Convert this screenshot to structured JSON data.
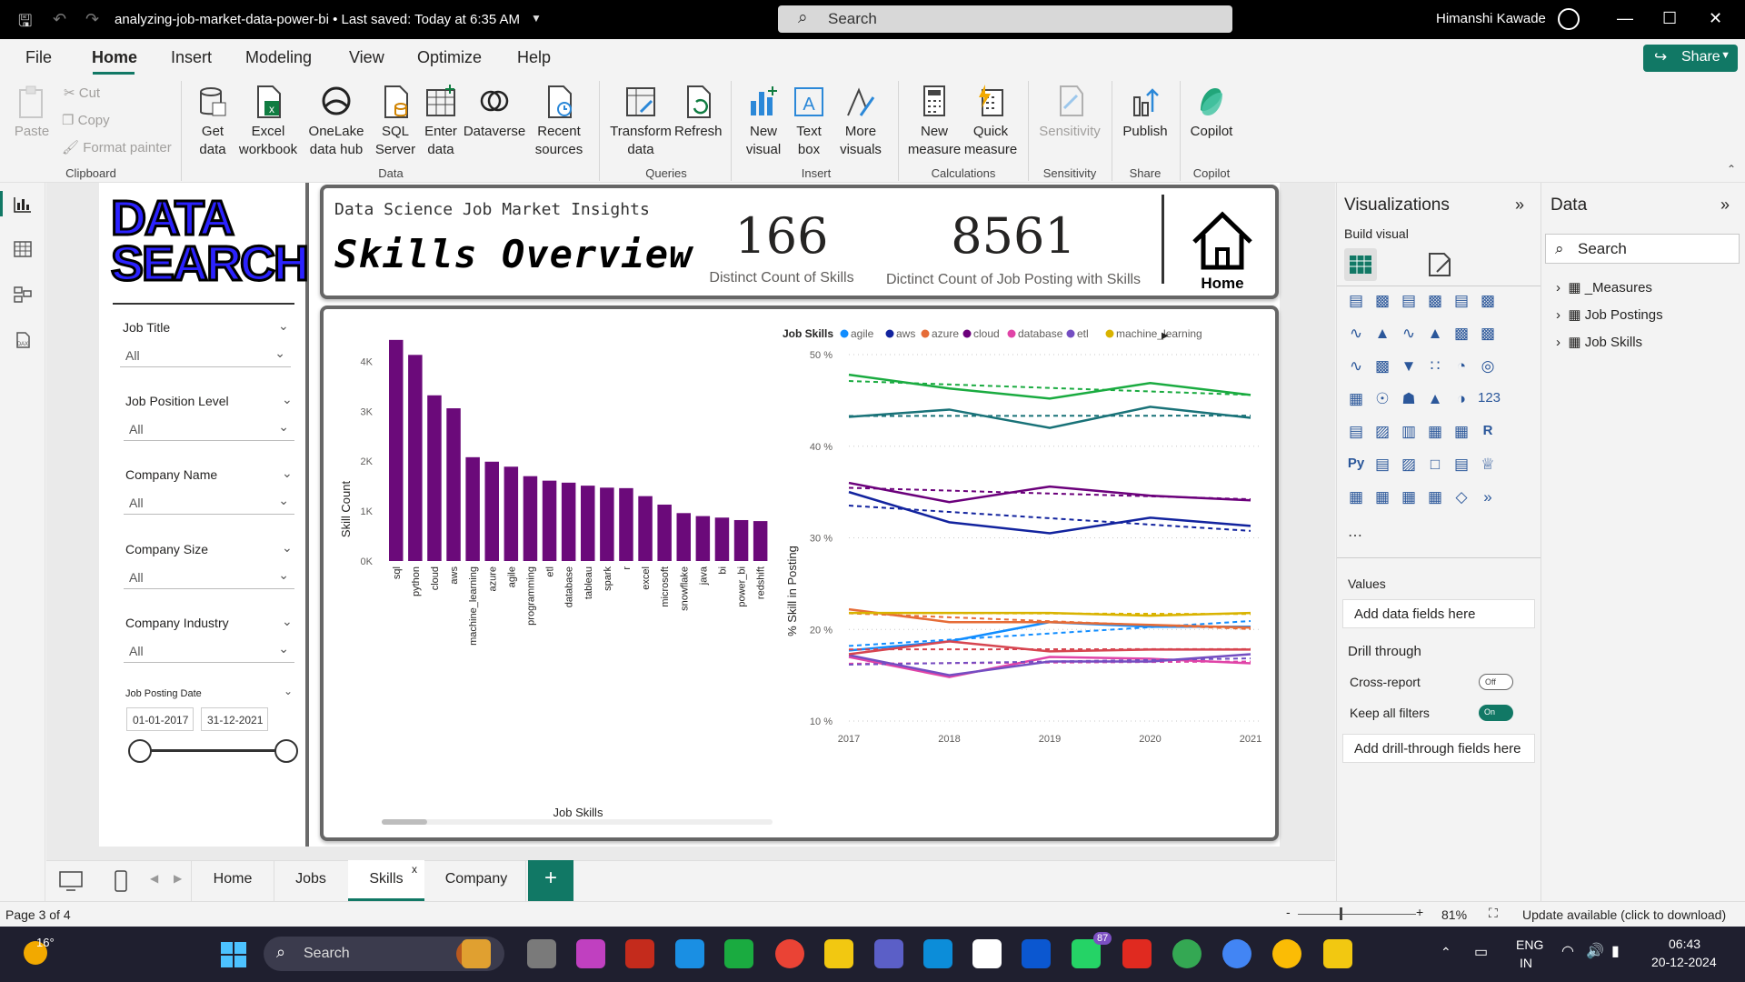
{
  "titlebar": {
    "file_title": "analyzing-job-market-data-power-bi • Last saved: Today at 6:35 AM",
    "search_placeholder": "Search",
    "user_name": "Himanshi Kawade"
  },
  "menu": [
    "File",
    "Home",
    "Insert",
    "Modeling",
    "View",
    "Optimize",
    "Help"
  ],
  "share_label": "Share",
  "ribbon": {
    "clipboard": {
      "paste": "Paste",
      "cut": "Cut",
      "copy": "Copy",
      "format_painter": "Format painter",
      "group": "Clipboard"
    },
    "data": {
      "get_data": "Get data",
      "excel": "Excel workbook",
      "onelake": "OneLake data hub",
      "sql": "SQL Server",
      "enter": "Enter data",
      "dataverse": "Dataverse",
      "recent": "Recent sources",
      "group": "Data"
    },
    "queries": {
      "transform": "Transform data",
      "refresh": "Refresh",
      "group": "Queries"
    },
    "insert": {
      "new_visual": "New visual",
      "text_box": "Text box",
      "more_visuals": "More visuals",
      "group": "Insert"
    },
    "calculations": {
      "new_measure": "New measure",
      "quick_measure": "Quick measure",
      "group": "Calculations"
    },
    "sensitivity": {
      "label": "Sensitivity",
      "group": "Sensitivity"
    },
    "share": {
      "publish": "Publish",
      "group": "Share"
    },
    "copilot": {
      "label": "Copilot",
      "group": "Copilot"
    }
  },
  "report": {
    "logo_line1": "DATA",
    "logo_line2": "SEARCH",
    "slicers": [
      {
        "label": "Job Title",
        "value": "All"
      },
      {
        "label": "Job Position Level",
        "value": "All"
      },
      {
        "label": "Company Name",
        "value": "All"
      },
      {
        "label": "Company Size",
        "value": "All"
      },
      {
        "label": "Company Industry",
        "value": "All"
      }
    ],
    "date_slicer": {
      "label": "Job Posting Date",
      "start": "01-01-2017",
      "end": "31-12-2021"
    },
    "header_small": "Data Science Job Market Insights",
    "header_big": "Skills Overview",
    "kpi1": {
      "value": "166",
      "label": "Distinct Count of Skills"
    },
    "kpi2": {
      "value": "8561",
      "label": "Dictinct Count of Job Posting with Skills"
    },
    "home_label": "Home"
  },
  "chart_data": [
    {
      "type": "bar",
      "xlabel": "Job Skills",
      "ylabel": "Skill Count",
      "ylim": [
        0,
        4500
      ],
      "yticks": [
        "0K",
        "1K",
        "2K",
        "3K",
        "4K"
      ],
      "categories": [
        "sql",
        "python",
        "cloud",
        "aws",
        "machine_learning",
        "azure",
        "agile",
        "programming",
        "etl",
        "database",
        "tableau",
        "spark",
        "r",
        "excel",
        "microsoft",
        "snowflake",
        "java",
        "bi",
        "power_bi",
        "redshift"
      ],
      "values": [
        4430,
        4130,
        3320,
        3060,
        2080,
        1990,
        1890,
        1700,
        1610,
        1570,
        1510,
        1470,
        1460,
        1300,
        1130,
        960,
        900,
        870,
        820,
        800
      ],
      "color": "#6b0a7a"
    },
    {
      "type": "line",
      "legend_title": "Job Skills",
      "xlabel": "",
      "ylabel": "% Skill in Posting",
      "x": [
        2017,
        2018,
        2019,
        2020,
        2021
      ],
      "ylim": [
        10,
        50
      ],
      "yticks": [
        "10 %",
        "20 %",
        "30 %",
        "40 %",
        "50 %"
      ],
      "legend": [
        {
          "name": "agile",
          "color": "#118dff"
        },
        {
          "name": "aws",
          "color": "#12239e"
        },
        {
          "name": "azure",
          "color": "#e66c37"
        },
        {
          "name": "cloud",
          "color": "#6b007b"
        },
        {
          "name": "database",
          "color": "#e044a7"
        },
        {
          "name": "etl",
          "color": "#744ec2"
        },
        {
          "name": "machine_learning",
          "color": "#d9b300"
        }
      ],
      "series": [
        {
          "name": "agile",
          "color": "#118dff",
          "values": [
            17.7,
            18.7,
            20.8,
            20.3,
            20.3
          ]
        },
        {
          "name": "aws",
          "color": "#12239e",
          "values": [
            35.0,
            31.7,
            30.5,
            32.2,
            31.3
          ]
        },
        {
          "name": "azure",
          "color": "#e66c37",
          "values": [
            22.2,
            20.8,
            20.8,
            20.5,
            20.2
          ]
        },
        {
          "name": "cloud",
          "color": "#6b007b",
          "values": [
            36.0,
            33.9,
            35.6,
            34.6,
            34.1
          ]
        },
        {
          "name": "database",
          "color": "#e044a7",
          "values": [
            17.0,
            14.8,
            17.0,
            16.8,
            16.3
          ]
        },
        {
          "name": "etl",
          "color": "#744ec2",
          "values": [
            17.2,
            15.0,
            16.5,
            16.5,
            17.3
          ]
        },
        {
          "name": "machine_learning",
          "color": "#d9b300",
          "values": [
            21.8,
            21.8,
            21.8,
            21.5,
            21.8
          ]
        },
        {
          "name": "",
          "color": "#1aab40",
          "values": [
            47.8,
            46.3,
            45.2,
            46.9,
            45.6
          ]
        },
        {
          "name": "",
          "color": "#197278",
          "values": [
            43.2,
            44.0,
            42.0,
            44.3,
            43.1
          ]
        },
        {
          "name": "",
          "color": "#d64550",
          "values": [
            17.3,
            18.7,
            17.6,
            17.8,
            17.8
          ]
        }
      ]
    }
  ],
  "viz_pane": {
    "title": "Visualizations",
    "build_visual": "Build visual",
    "values_label": "Values",
    "add_data_fields": "Add data fields here",
    "drill_through": "Drill through",
    "cross_report": "Cross-report",
    "cross_report_toggle": "Off",
    "keep_all_filters": "Keep all filters",
    "keep_filters_toggle": "On",
    "add_drill_fields": "Add drill-through fields here"
  },
  "data_pane": {
    "title": "Data",
    "search_placeholder": "Search",
    "tables": [
      "_Measures",
      "Job Postings",
      "Job Skills"
    ]
  },
  "tabs": [
    "Home",
    "Jobs",
    "Skills",
    "Company"
  ],
  "status": {
    "page": "Page 3 of 4",
    "zoom": "81%",
    "update": "Update available (click to download)"
  },
  "taskbar": {
    "weather": "16°",
    "search_placeholder": "Search",
    "teams_badge": "87",
    "lang": "ENG",
    "region": "IN",
    "time": "06:43",
    "date": "20-12-2024"
  }
}
